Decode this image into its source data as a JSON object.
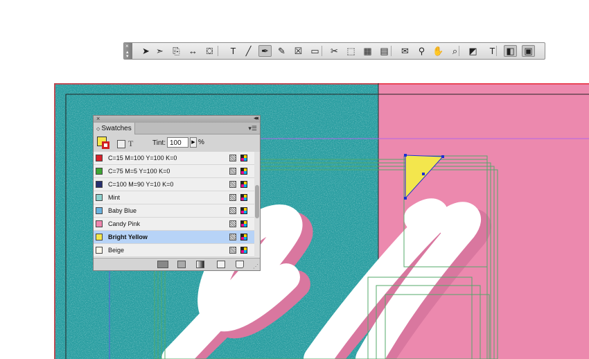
{
  "toolbar": {
    "tools": [
      {
        "name": "selection-tool-icon",
        "glyph": "➤"
      },
      {
        "name": "direct-selection-tool-icon",
        "glyph": "➣"
      },
      {
        "name": "page-tool-icon",
        "glyph": "⎘"
      },
      {
        "name": "gap-tool-icon",
        "glyph": "↔"
      },
      {
        "name": "content-collector-tool-icon",
        "glyph": "⛋"
      },
      {
        "name": "type-tool-icon",
        "glyph": "T"
      },
      {
        "name": "line-tool-icon",
        "glyph": "╱"
      },
      {
        "name": "pen-tool-icon",
        "glyph": "✒",
        "active": true
      },
      {
        "name": "pencil-tool-icon",
        "glyph": "✎"
      },
      {
        "name": "rectangle-frame-tool-icon",
        "glyph": "☒"
      },
      {
        "name": "rectangle-tool-icon",
        "glyph": "▭"
      },
      {
        "name": "scissors-tool-icon",
        "glyph": "✂"
      },
      {
        "name": "free-transform-tool-icon",
        "glyph": "⬚"
      },
      {
        "name": "gradient-swatch-tool-icon",
        "glyph": "▦"
      },
      {
        "name": "gradient-feather-tool-icon",
        "glyph": "▤"
      },
      {
        "name": "note-tool-icon",
        "glyph": "✉"
      },
      {
        "name": "eyedropper-tool-icon",
        "glyph": "⚲"
      },
      {
        "name": "hand-tool-icon",
        "glyph": "✋"
      },
      {
        "name": "zoom-tool-icon",
        "glyph": "⌕"
      },
      {
        "name": "fill-stroke-icon",
        "glyph": "◩"
      },
      {
        "name": "formatting-affects-icon",
        "glyph": "T"
      },
      {
        "name": "normal-view-icon",
        "glyph": "◧",
        "active": true
      },
      {
        "name": "screen-mode-icon",
        "glyph": "▣",
        "active": true
      }
    ]
  },
  "swatches_panel": {
    "tab_label": "Swatches",
    "tint_label": "Tint:",
    "tint_value": "100",
    "tint_unit": "%",
    "swatches": [
      {
        "name": "C=15 M=100 Y=100 K=0",
        "color": "#d7232c"
      },
      {
        "name": "C=75 M=5 Y=100 K=0",
        "color": "#3fa535"
      },
      {
        "name": "C=100 M=90 Y=10 K=0",
        "color": "#27306f"
      },
      {
        "name": "Mint",
        "color": "#8ed1ce"
      },
      {
        "name": "Baby Blue",
        "color": "#6ab2de"
      },
      {
        "name": "Candy Pink",
        "color": "#ee86ae"
      },
      {
        "name": "Bright Yellow",
        "color": "#f3e64d",
        "selected": true
      },
      {
        "name": "Beige",
        "color": "#fbf7ea"
      }
    ]
  },
  "document": {
    "colors": {
      "teal_background": "#2a9ea1",
      "pink_background": "#ec89ae",
      "lettering_white": "#ffffff",
      "lettering_shadow": "#d9779f",
      "selected_shape_fill": "#f3e64d",
      "selection_color": "#1c2fd1"
    }
  }
}
